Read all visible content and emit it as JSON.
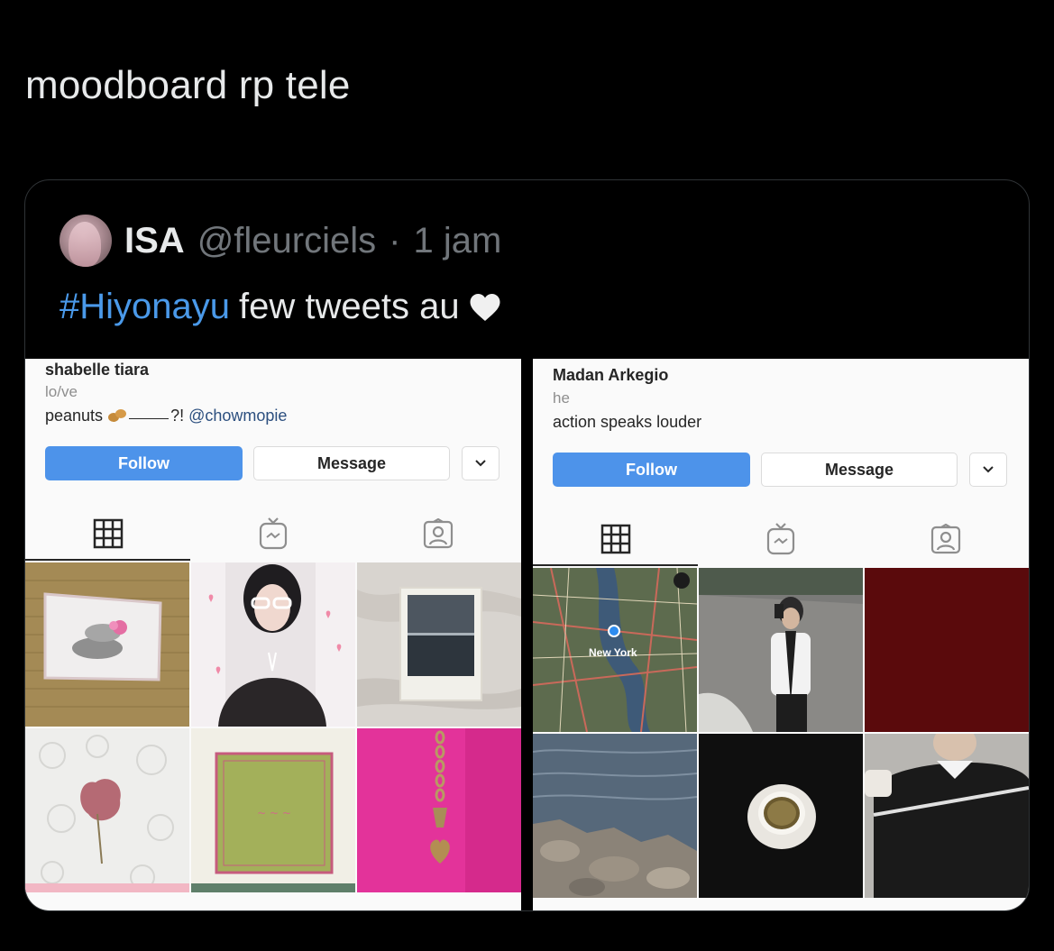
{
  "tweet": {
    "text": "moodboard rp tele"
  },
  "quote": {
    "display_name": "ISA",
    "handle": "@fleurciels",
    "separator": "·",
    "time": "1 jam",
    "hashtag": "#Hiyonayu",
    "body": "few tweets au",
    "heart_icon": "white-heart-icon"
  },
  "profile_left": {
    "name": "shabelle tiara",
    "pronoun": "lo/ve",
    "bio_prefix": "peanuts",
    "bio_suffix": "?!",
    "mention": "@chowmopie",
    "follow_label": "Follow",
    "message_label": "Message",
    "tabs": [
      "grid-icon",
      "igtv-icon",
      "tagged-icon"
    ],
    "posts": [
      "framed stones and pink orchid picture on brick wall",
      "girl with white glasses and pink hearts",
      "instant photo of ocean on white sheets",
      "pressed pink flower on white lace",
      "green embroidered cloth with pink border",
      "gold chain with heart charm on pink"
    ]
  },
  "profile_right": {
    "name": "Madan Arkegio",
    "pronoun": "he",
    "bio": "action speaks louder",
    "follow_label": "Follow",
    "message_label": "Message",
    "map_label": "New York",
    "tabs": [
      "grid-icon",
      "igtv-icon",
      "tagged-icon"
    ],
    "posts": [
      "map of New York",
      "boy taking mirror selfie outdoors",
      "dark red square",
      "rocky shoreline and water",
      "coffee cup on black background",
      "person in black sweater"
    ]
  },
  "colors": {
    "background": "#000000",
    "text": "#e7e9ea",
    "muted": "#71767b",
    "hashtag": "#4a99e9",
    "follow_button": "#4d93ea",
    "dark_red": "#5a0a0c"
  }
}
